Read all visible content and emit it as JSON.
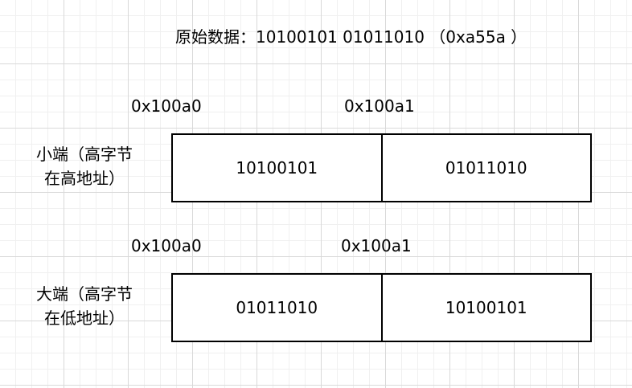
{
  "raw_data": {
    "text": "原始数据：10100101 01011010 （0xa55a ）"
  },
  "little_endian": {
    "addresses": [
      "0x100a0",
      "0x100a1"
    ],
    "label_line1": "小端（高字节",
    "label_line2": "在高地址）",
    "bytes": [
      "10100101",
      "01011010"
    ]
  },
  "big_endian": {
    "addresses": [
      "0x100a0",
      "0x100a1"
    ],
    "label_line1": "大端（高字节",
    "label_line2": "在低地址）",
    "bytes": [
      "01011010",
      "10100101"
    ]
  }
}
